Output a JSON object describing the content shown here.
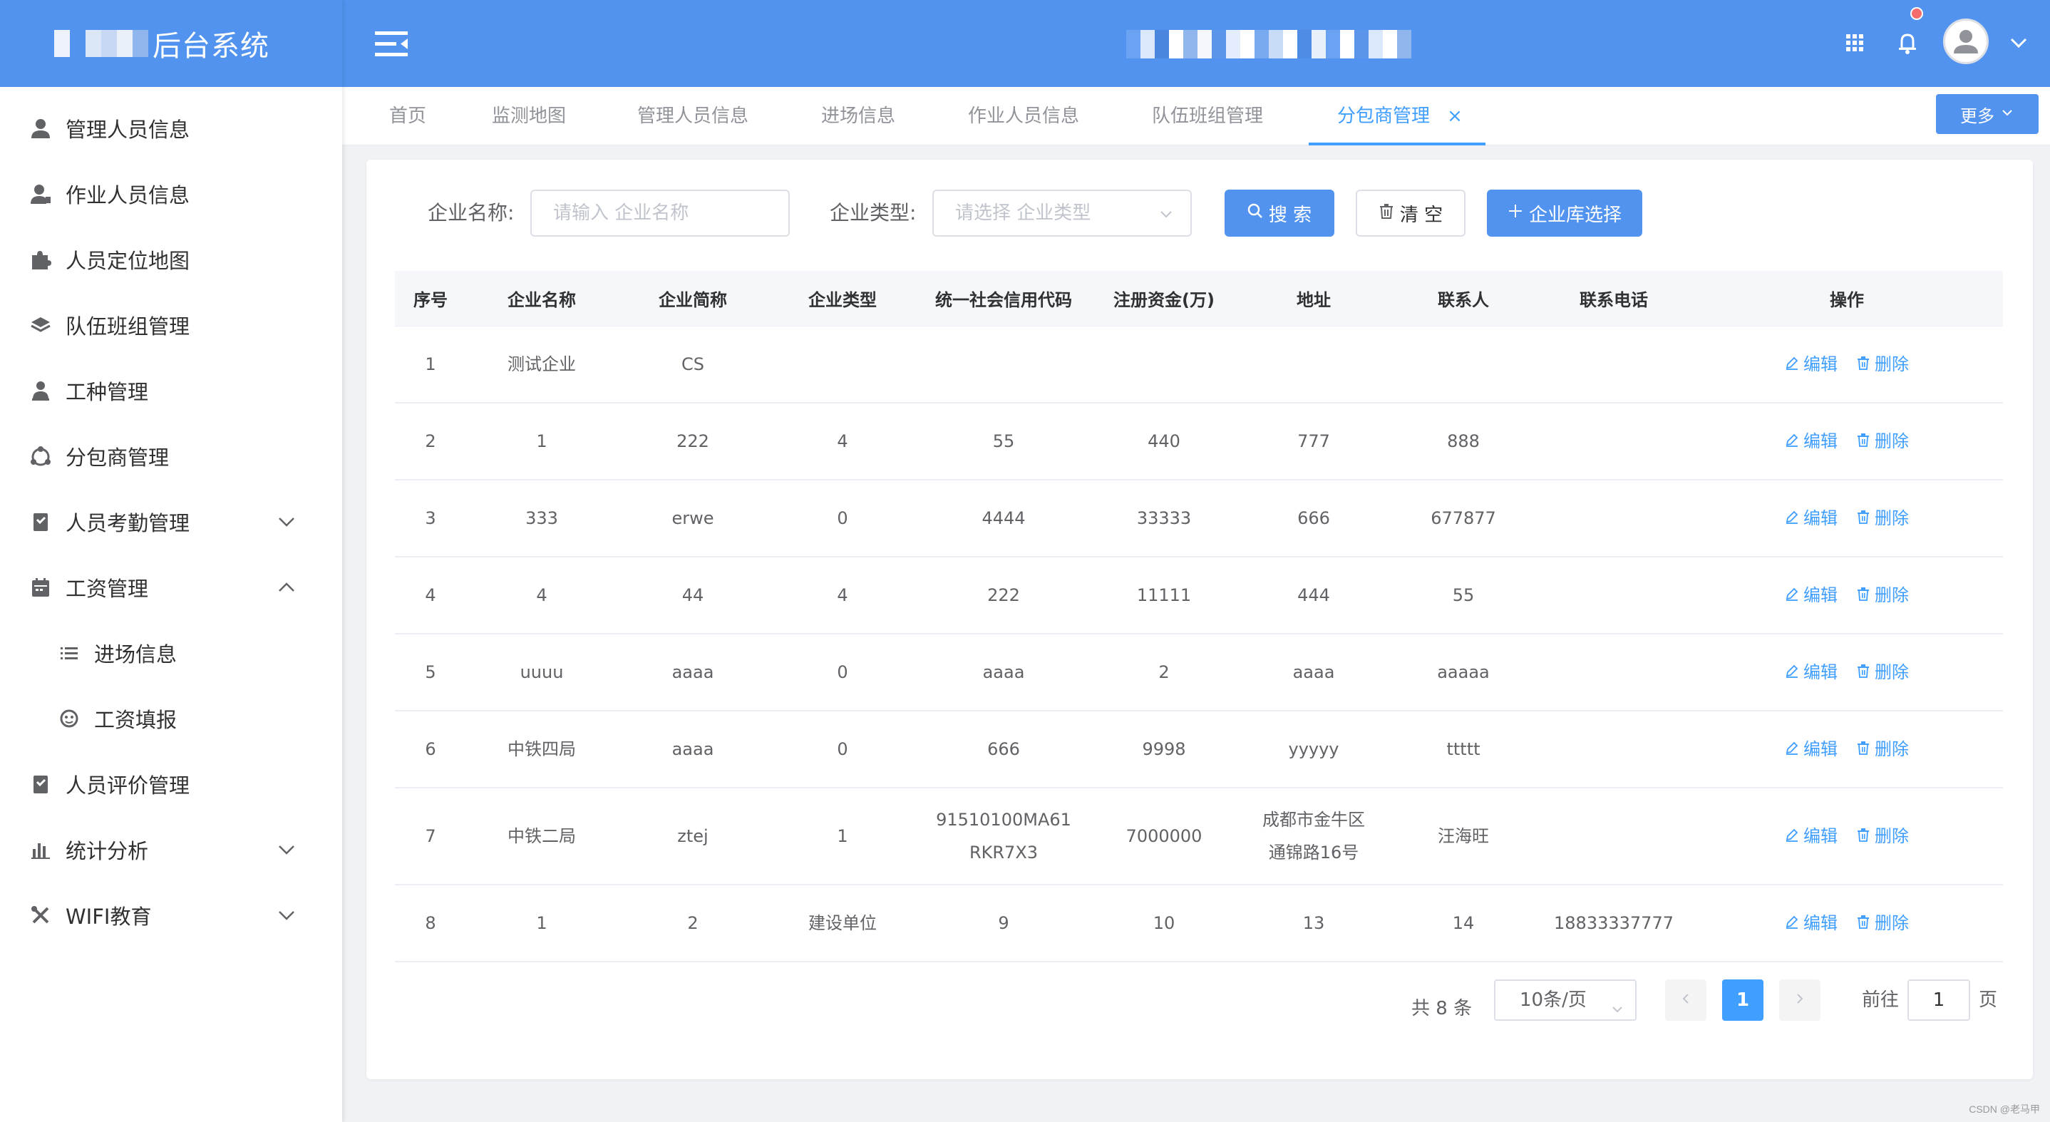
{
  "app": {
    "title": "后台系统"
  },
  "sidebar": {
    "items": [
      {
        "label": "管理人员信息"
      },
      {
        "label": "作业人员信息"
      },
      {
        "label": "人员定位地图"
      },
      {
        "label": "队伍班组管理"
      },
      {
        "label": "工种管理"
      },
      {
        "label": "分包商管理"
      },
      {
        "label": "人员考勤管理",
        "expanded": false
      },
      {
        "label": "工资管理",
        "expanded": true
      },
      {
        "label": "进场信息"
      },
      {
        "label": "工资填报"
      },
      {
        "label": "人员评价管理"
      },
      {
        "label": "统计分析",
        "expanded": false
      },
      {
        "label": "WIFI教育",
        "expanded": false
      }
    ]
  },
  "tabs": [
    {
      "label": "首页"
    },
    {
      "label": "监测地图"
    },
    {
      "label": "管理人员信息"
    },
    {
      "label": "进场信息"
    },
    {
      "label": "作业人员信息"
    },
    {
      "label": "队伍班组管理"
    },
    {
      "label": "分包商管理",
      "active": true
    }
  ],
  "tab_close": "×",
  "more_label": "更多",
  "filter": {
    "name_label": "企业名称:",
    "name_placeholder": "请输入 企业名称",
    "type_label": "企业类型:",
    "type_placeholder": "请选择 企业类型",
    "search_label": "搜 索",
    "clear_label": "清 空",
    "library_label": "企业库选择"
  },
  "table": {
    "headers": [
      "序号",
      "企业名称",
      "企业简称",
      "企业类型",
      "统一社会信用代码",
      "注册资金(万)",
      "地址",
      "联系人",
      "联系电话",
      "操作"
    ],
    "edit_label": "编辑",
    "delete_label": "删除",
    "rows": [
      [
        "1",
        "测试企业",
        "CS",
        "",
        "",
        "",
        "",
        "",
        ""
      ],
      [
        "2",
        "1",
        "222",
        "4",
        "55",
        "440",
        "777",
        "888",
        ""
      ],
      [
        "3",
        "333",
        "erwe",
        "0",
        "4444",
        "33333",
        "666",
        "677877",
        ""
      ],
      [
        "4",
        "4",
        "44",
        "4",
        "222",
        "11111",
        "444",
        "55",
        ""
      ],
      [
        "5",
        "uuuu",
        "aaaa",
        "0",
        "aaaa",
        "2",
        "aaaa",
        "aaaaa",
        ""
      ],
      [
        "6",
        "中铁四局",
        "aaaa",
        "0",
        "666",
        "9998",
        "yyyyy",
        "ttttt",
        ""
      ],
      [
        "7",
        "中铁二局",
        "ztej",
        "1",
        "91510100MA61RKR7X3",
        "7000000",
        "成都市金牛区通锦路16号",
        "汪海旺",
        ""
      ],
      [
        "8",
        "1",
        "2",
        "建设单位",
        "9",
        "10",
        "13",
        "14",
        "18833337777"
      ]
    ]
  },
  "pagination": {
    "total_text": "共 8 条",
    "page_size": "10条/页",
    "current_page": "1",
    "goto_label": "前往",
    "goto_value": "1",
    "page_unit": "页"
  },
  "watermark": "CSDN @老马甲",
  "colors": {
    "brand": "#5193ef",
    "accent": "#409eff",
    "danger": "#f56c6c"
  }
}
